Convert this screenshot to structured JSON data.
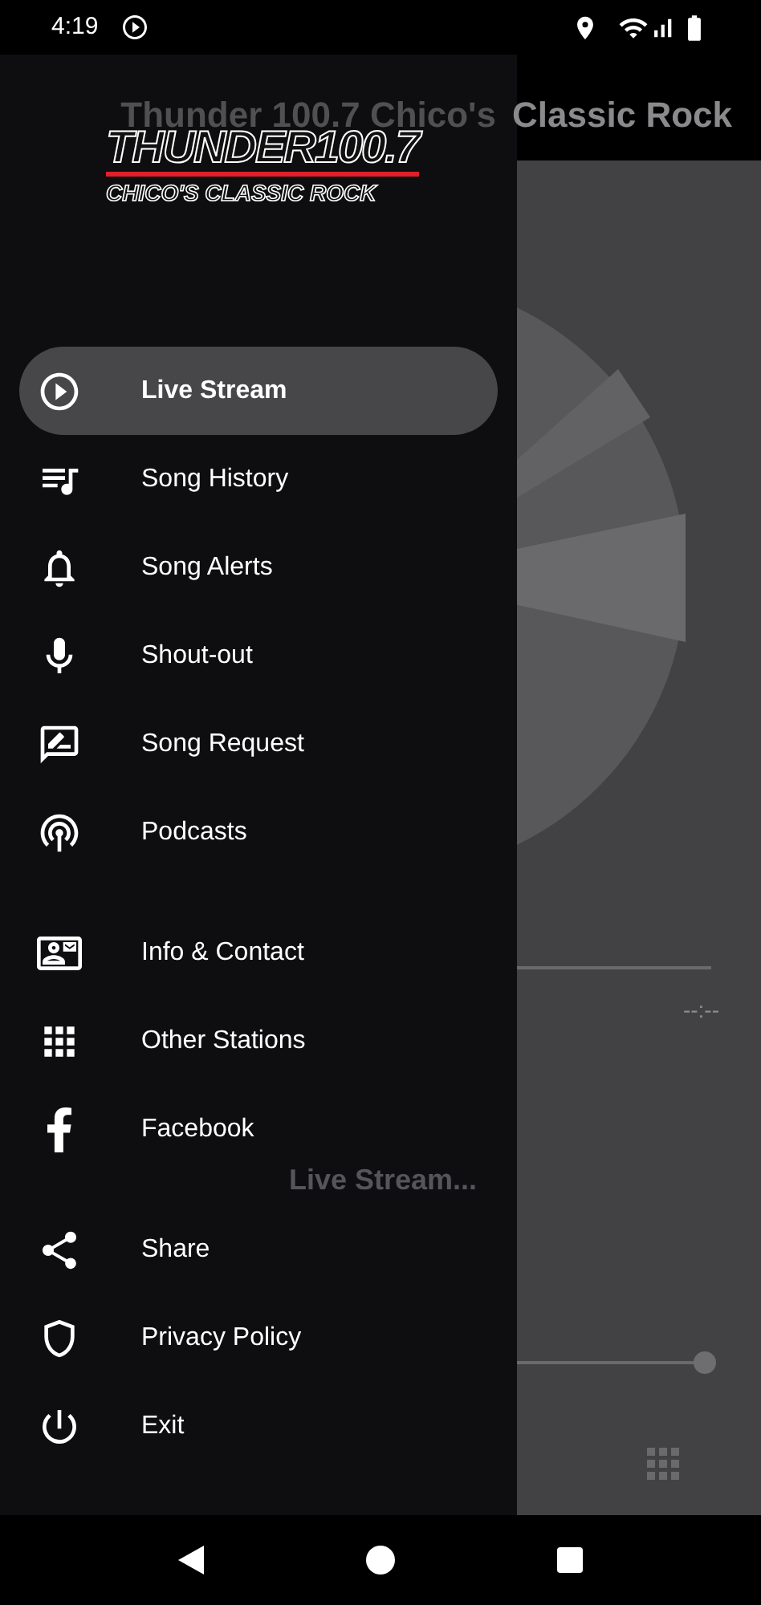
{
  "status_bar": {
    "time": "4:19"
  },
  "app_bar": {
    "title_parts": [
      "Thunder 100.7  Chico's",
      "Classic Rock"
    ]
  },
  "player": {
    "status": "Live Stream...",
    "time": "--:--",
    "volume": {
      "level": 1
    }
  },
  "drawer": {
    "logo": {
      "name": "THUNDER100.7",
      "tagline": "CHICO'S CLASSIC ROCK"
    },
    "groups": [
      [
        {
          "label": "Live Stream",
          "selected": true
        },
        {
          "label": "Song History",
          "selected": false
        },
        {
          "label": "Song Alerts",
          "selected": false
        },
        {
          "label": "Shout-out",
          "selected": false
        },
        {
          "label": "Song Request",
          "selected": false
        },
        {
          "label": "Podcasts",
          "selected": false
        }
      ],
      [
        {
          "label": "Info & Contact",
          "selected": false
        },
        {
          "label": "Other Stations",
          "selected": false
        },
        {
          "label": "Facebook",
          "selected": false
        }
      ],
      [
        {
          "label": "Share",
          "selected": false
        },
        {
          "label": "Privacy Policy",
          "selected": false
        },
        {
          "label": "Exit",
          "selected": false
        }
      ]
    ]
  }
}
